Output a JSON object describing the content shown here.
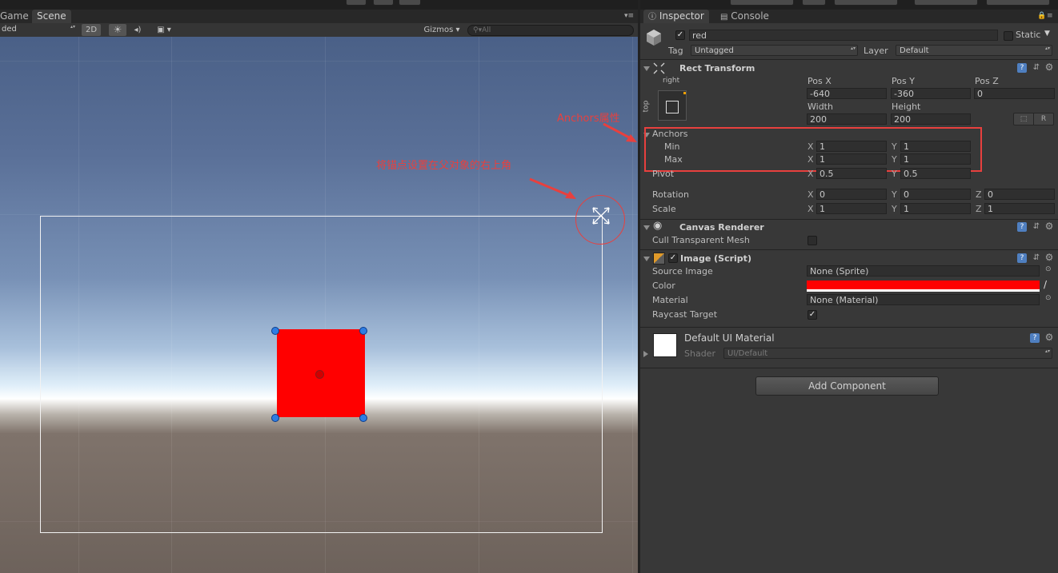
{
  "scene": {
    "tabs": [
      {
        "label": "Game"
      },
      {
        "label": "Scene"
      }
    ],
    "toolbar": {
      "shading_mode": "ded",
      "mode_2d": "2D",
      "gizmos": "Gizmos",
      "search_placeholder": "All"
    },
    "annotations": {
      "anchors_label": "Anchors属性",
      "anchor_position_note": "将锚点设置在父对象的右上角"
    }
  },
  "inspector": {
    "tabs": [
      {
        "label": "Inspector"
      },
      {
        "label": "Console"
      }
    ],
    "object": {
      "active": true,
      "name": "red",
      "static_label": "Static",
      "static_checked": false,
      "tag_label": "Tag",
      "tag_value": "Untagged",
      "layer_label": "Layer",
      "layer_value": "Default"
    },
    "rect_transform": {
      "title": "Rect Transform",
      "anchor_preset_h": "right",
      "anchor_preset_v": "top",
      "pos_x_label": "Pos X",
      "pos_x": "-640",
      "pos_y_label": "Pos Y",
      "pos_y": "-360",
      "pos_z_label": "Pos Z",
      "pos_z": "0",
      "width_label": "Width",
      "width": "200",
      "height_label": "Height",
      "height": "200",
      "raw_button": "R",
      "anchors_label": "Anchors",
      "min_label": "Min",
      "min_x": "1",
      "min_y": "1",
      "max_label": "Max",
      "max_x": "1",
      "max_y": "1",
      "pivot_label": "Pivot",
      "pivot_x": "0.5",
      "pivot_y": "0.5",
      "rotation_label": "Rotation",
      "rot_x": "0",
      "rot_y": "0",
      "rot_z": "0",
      "scale_label": "Scale",
      "scale_x": "1",
      "scale_y": "1",
      "scale_z": "1",
      "axis_x": "X",
      "axis_y": "Y",
      "axis_z": "Z"
    },
    "canvas_renderer": {
      "title": "Canvas Renderer",
      "cull_label": "Cull Transparent Mesh",
      "cull_checked": false
    },
    "image": {
      "title": "Image (Script)",
      "enabled": true,
      "source_label": "Source Image",
      "source_value": "None (Sprite)",
      "color_label": "Color",
      "color_value": "#ff0000",
      "material_label": "Material",
      "material_value": "None (Material)",
      "raycast_label": "Raycast Target",
      "raycast_checked": true
    },
    "material": {
      "title": "Default UI Material",
      "shader_label": "Shader",
      "shader_value": "UI/Default"
    },
    "add_component": "Add Component"
  },
  "colors": {
    "annotation": "#e8403e",
    "image_color": "#ff0000",
    "handle": "#2f7de2"
  }
}
